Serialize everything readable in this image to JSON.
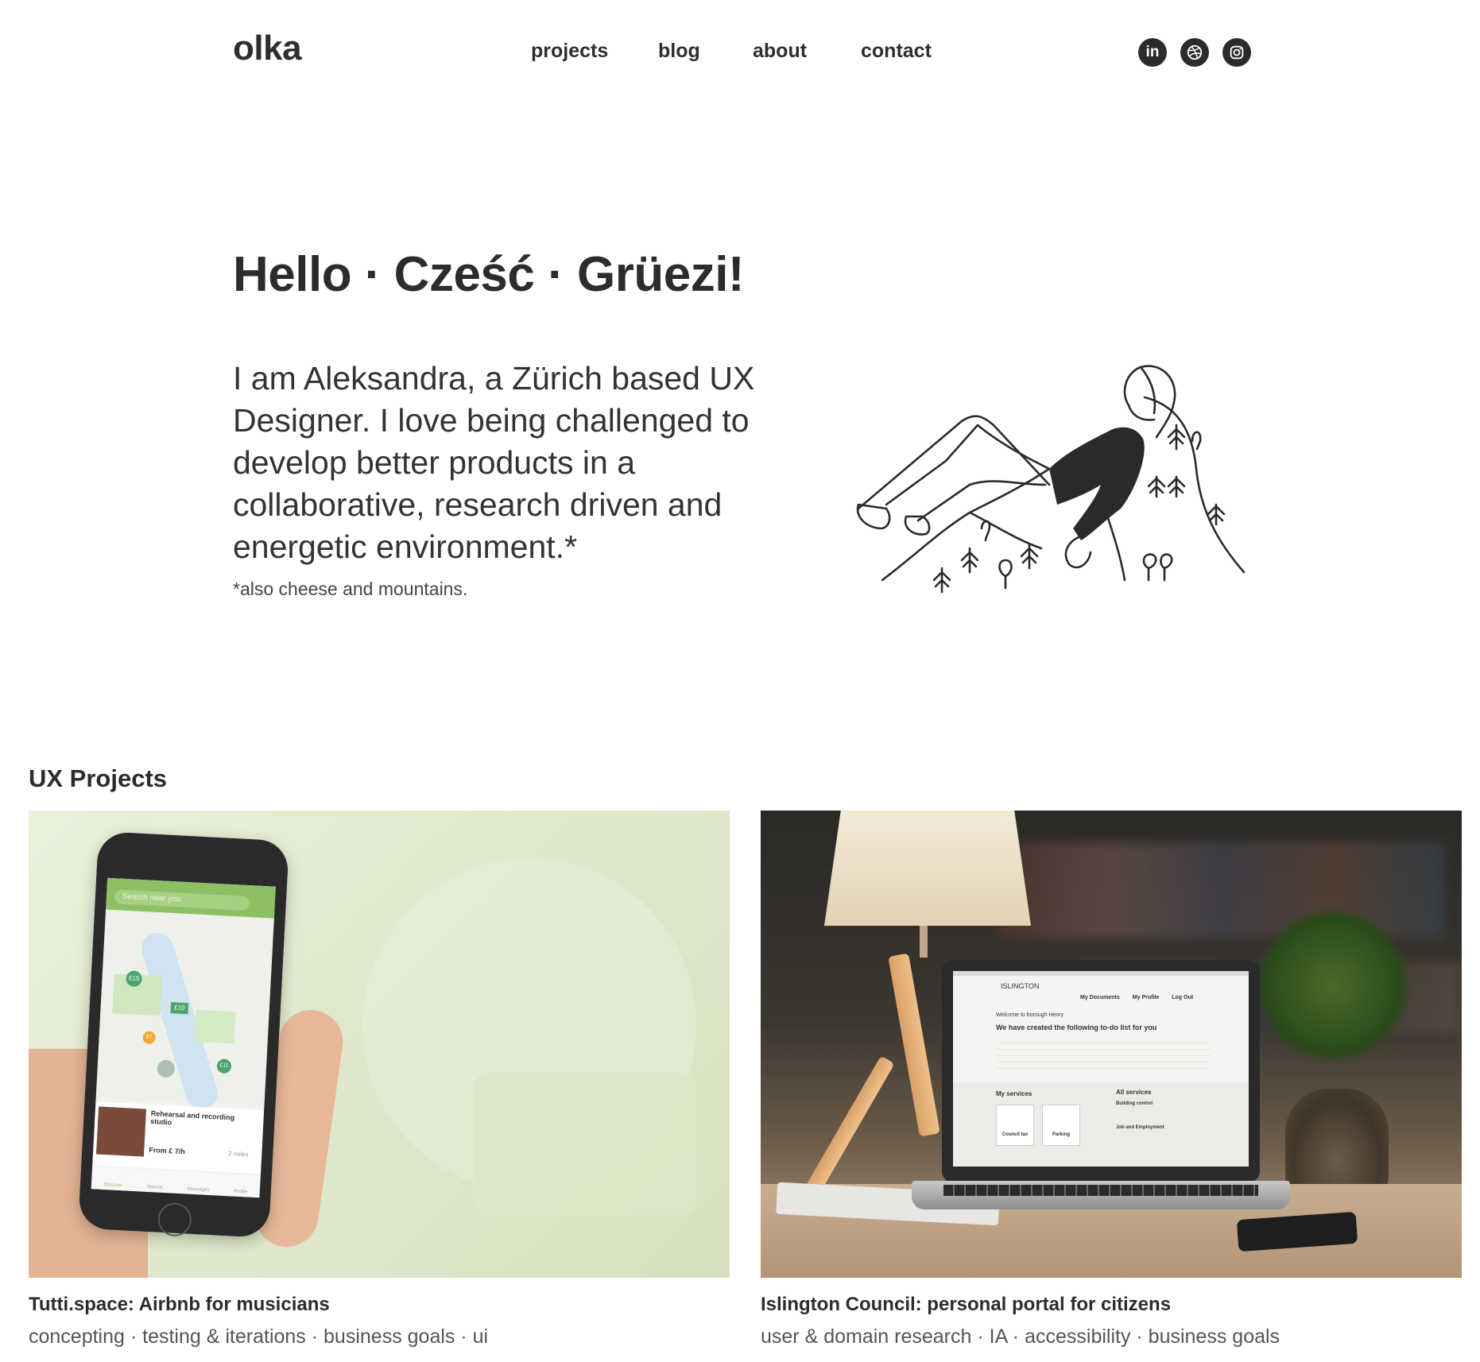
{
  "header": {
    "logo": "olka",
    "nav": [
      "projects",
      "blog",
      "about",
      "contact"
    ],
    "social": [
      {
        "icon": "linkedin-icon",
        "label": "in"
      },
      {
        "icon": "dribbble-icon"
      },
      {
        "icon": "instagram-icon"
      }
    ]
  },
  "hero": {
    "title": "Hello · Cześć · Grüezi!",
    "text": "I am Aleksandra, a Zürich based UX Designer. I love being challenged to develop better products in a collaborative, research driven and energetic environment.*",
    "note": "*also cheese and mountains.",
    "illustration": "woman-lying-on-mountain-illustration"
  },
  "projects": {
    "title": "UX Projects",
    "items": [
      {
        "title": "Tutti.space: Airbnb for musicians",
        "tags": "concepting · testing & iterations · business goals · ui",
        "image": "phone-with-map-app",
        "phone": {
          "search": "Search near you",
          "listing_title": "Rehearsal and recording studio",
          "listing_price": "From £ 7/h",
          "listing_distance": "2 miles",
          "tabs": [
            "Discover",
            "Spaces",
            "Messages",
            "Profile"
          ],
          "pins": [
            "£15",
            "£10",
            "£7",
            "£11"
          ]
        }
      },
      {
        "title": "Islington Council: personal portal for citizens",
        "tags": "user & domain research · IA · accessibility · business goals",
        "image": "laptop-on-desk",
        "laptop": {
          "brand": "ISLINGTON",
          "nav": [
            "My Documents",
            "My Profile",
            "Log Out"
          ],
          "welcome": "Welcome to borough Henry",
          "todo_title": "We have created the following to-do list for you",
          "my_services": "My services",
          "all_services": "All services",
          "services": [
            "Council tax",
            "Parking"
          ],
          "building": "Building control",
          "jobs": "Job and Employment"
        }
      }
    ]
  },
  "colors": {
    "text": "#2c2c2c",
    "social_bg": "#2b2b2b",
    "tutti_green": "#8cc063",
    "card1_bg": "#e3ecd2"
  }
}
